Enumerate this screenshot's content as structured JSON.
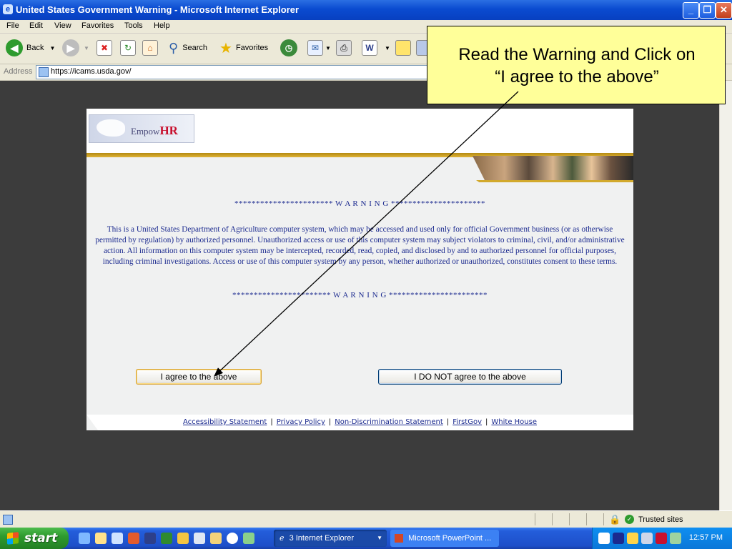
{
  "window": {
    "title": "United States Government Warning - Microsoft Internet Explorer"
  },
  "menu": [
    "File",
    "Edit",
    "View",
    "Favorites",
    "Tools",
    "Help"
  ],
  "toolbar": {
    "back_label": "Back",
    "search_label": "Search",
    "favorites_label": "Favorites"
  },
  "address": {
    "label": "Address",
    "url": "https://icams.usda.gov/"
  },
  "page": {
    "logo_text_a": "Empow",
    "logo_text_b": "HR",
    "warning_line": "*********************** W A R N I N G **********************",
    "warning_line_bottom": "*********************** W A R N I N G ***********************",
    "warning_body": "This is a United States Department of Agriculture computer system, which may be accessed and used only for official Government business (or as otherwise permitted by regulation) by authorized personnel. Unauthorized access or use of this computer system may subject violators to criminal, civil, and/or administrative action. All information on this computer system may be intercepted, recorded, read, copied, and disclosed by and to authorized personnel for official purposes, including criminal investigations. Access or use of this computer system by any person, whether authorized or unauthorized, constitutes consent to these terms.",
    "agree_label": "I agree to the above",
    "disagree_label": "I DO NOT agree to the above",
    "footer_links": [
      "Accessibility Statement",
      "Privacy Policy",
      "Non-Discrimination Statement",
      "FirstGov",
      "White House"
    ]
  },
  "status": {
    "zone": "Trusted sites"
  },
  "taskbar": {
    "start_label": "start",
    "tasks": [
      "3 Internet Explorer",
      "Microsoft PowerPoint ..."
    ],
    "clock": "12:57 PM"
  },
  "callout": {
    "line1": "Read the Warning and Click on",
    "line2": "“I agree to the above”"
  },
  "colors": {
    "accent": "#1b2a8f",
    "gold": "#d2a92c",
    "callout": "#ffff99"
  }
}
